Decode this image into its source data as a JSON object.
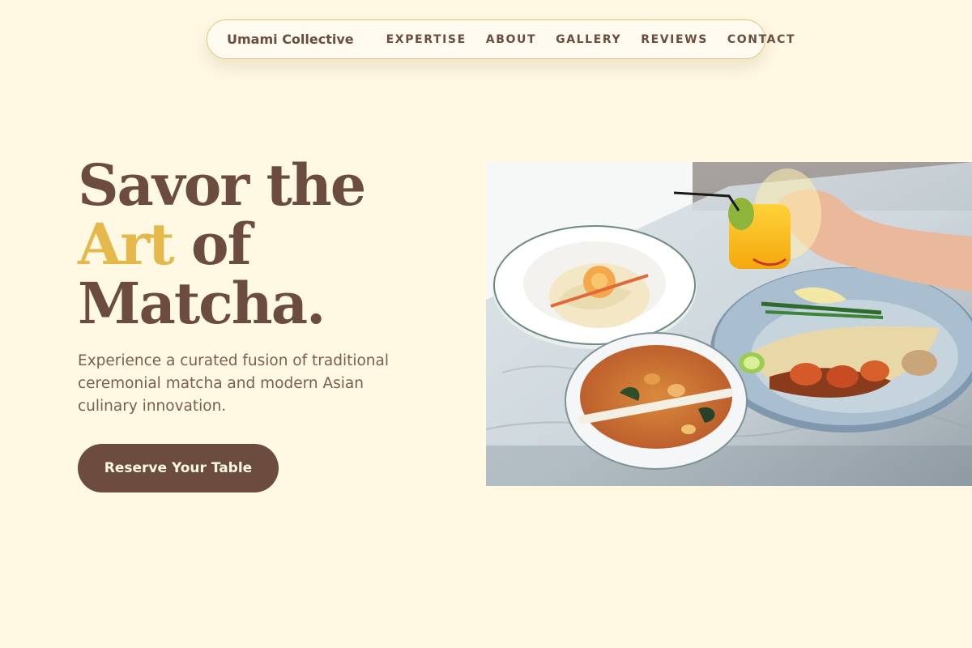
{
  "nav": {
    "brand": "Umami Collective",
    "items": [
      {
        "label": "EXPERTISE"
      },
      {
        "label": "ABOUT"
      },
      {
        "label": "GALLERY"
      },
      {
        "label": "REVIEWS"
      },
      {
        "label": "CONTACT"
      }
    ]
  },
  "hero": {
    "headline_line1": "Savor the",
    "headline_accent": "Art",
    "headline_line2_rest": " of",
    "headline_line3": "Matcha.",
    "description": "Experience a curated fusion of traditional ceremonial matcha and modern Asian culinary innovation.",
    "cta_label": "Reserve Your Table"
  },
  "colors": {
    "background": "#fff8e3",
    "primary_brown": "#6b4c3f",
    "accent_gold": "#e4b84b"
  }
}
